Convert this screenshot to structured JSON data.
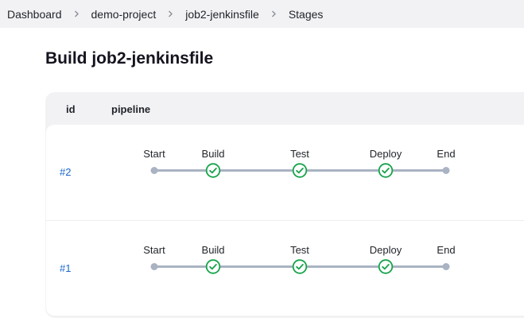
{
  "breadcrumb": [
    "Dashboard",
    "demo-project",
    "job2-jenkinsfile",
    "Stages"
  ],
  "page_title": "Build job2-jenkinsfile",
  "table": {
    "columns": [
      "id",
      "pipeline"
    ],
    "runs": [
      {
        "id": "#2",
        "stages": [
          "Start",
          "Build",
          "Test",
          "Deploy",
          "End"
        ]
      },
      {
        "id": "#1",
        "stages": [
          "Start",
          "Build",
          "Test",
          "Deploy",
          "End"
        ]
      }
    ]
  },
  "colors": {
    "success": "#16a34a",
    "track": "#a9b3c3",
    "link": "#1a67c9"
  }
}
